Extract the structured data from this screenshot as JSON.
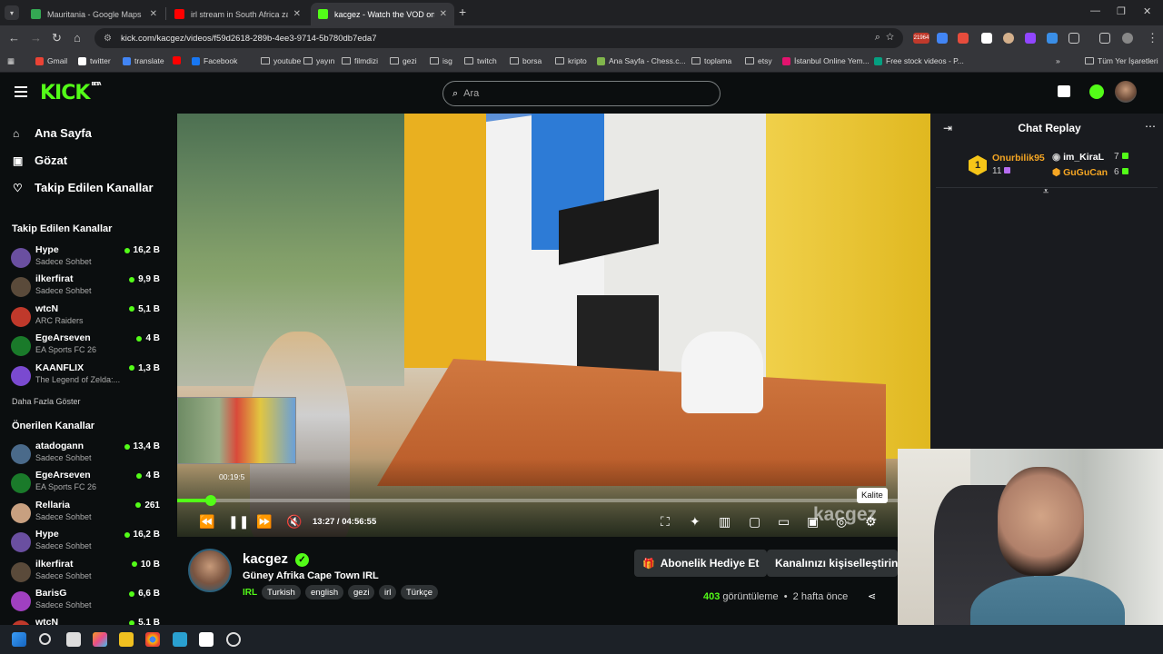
{
  "browser": {
    "tabs": [
      {
        "title": "Mauritania - Google Maps",
        "favicon_color": "#34a853"
      },
      {
        "title": "irl stream in South Africa za (Ne",
        "favicon_color": "#ff0000"
      },
      {
        "title": "kacgez - Watch the VOD on Kic",
        "favicon_color": "#53fc18",
        "active": true
      }
    ],
    "url": "kick.com/kacgez/videos/f59d2618-289b-4ee3-9714-5b780db7eda7",
    "extension_badge": "21964",
    "bookmarks": [
      {
        "label": "Gmail",
        "icon": "gmail-icon",
        "color": "#ea4335"
      },
      {
        "label": "twitter",
        "icon": "x-icon",
        "color": "#ffffff"
      },
      {
        "label": "translate",
        "icon": "translate-icon",
        "color": "#4285f4"
      },
      {
        "label": "",
        "icon": "youtube-icon",
        "color": "#ff0000"
      },
      {
        "label": "Facebook",
        "icon": "facebook-icon",
        "color": "#1877f2"
      },
      {
        "label": "youtube",
        "icon": "folder-icon",
        "color": ""
      },
      {
        "label": "yayın",
        "icon": "folder-icon",
        "color": ""
      },
      {
        "label": "filmdizi",
        "icon": "folder-icon",
        "color": ""
      },
      {
        "label": "gezi",
        "icon": "folder-icon",
        "color": ""
      },
      {
        "label": "isg",
        "icon": "folder-icon",
        "color": ""
      },
      {
        "label": "twitch",
        "icon": "folder-icon",
        "color": ""
      },
      {
        "label": "borsa",
        "icon": "folder-icon",
        "color": ""
      },
      {
        "label": "kripto",
        "icon": "folder-icon",
        "color": ""
      },
      {
        "label": "Ana Sayfa - Chess.c...",
        "icon": "chess-icon",
        "color": "#81b64c"
      },
      {
        "label": "toplama",
        "icon": "folder-icon",
        "color": ""
      },
      {
        "label": "etsy",
        "icon": "folder-icon",
        "color": ""
      },
      {
        "label": "İstanbul Online Yem...",
        "icon": "yemeksepeti-icon",
        "color": "#e2136e"
      },
      {
        "label": "Free stock videos - P...",
        "icon": "pexels-icon",
        "color": "#05a081"
      }
    ],
    "all_bookmarks": "Tüm Yer İşaretleri"
  },
  "kick": {
    "logo_text": "KICK",
    "logo_sup": "BETA",
    "search_placeholder": "Ara",
    "accent": "#53fc18"
  },
  "sidebar": {
    "nav": [
      {
        "label": "Ana Sayfa",
        "icon": "home-icon"
      },
      {
        "label": "Gözat",
        "icon": "browse-icon"
      },
      {
        "label": "Takip Edilen Kanallar",
        "icon": "heart-icon"
      }
    ],
    "followed_title": "Takip Edilen Kanallar",
    "followed": [
      {
        "name": "Hype",
        "sub": "Sadece Sohbet",
        "viewers": "16,2 B",
        "avatar_color": "#6a4fa0"
      },
      {
        "name": "ilkerfirat",
        "sub": "Sadece Sohbet",
        "viewers": "9,9 B",
        "avatar_color": "#5a4a3a"
      },
      {
        "name": "wtcN",
        "sub": "ARC Raiders",
        "viewers": "5,1 B",
        "avatar_color": "#c0392b"
      },
      {
        "name": "EgeArseven",
        "sub": "EA Sports FC 26",
        "viewers": "4 B",
        "avatar_color": "#1a7a2a"
      },
      {
        "name": "KAANFLIX",
        "sub": "The Legend of Zelda:...",
        "viewers": "1,3 B",
        "avatar_color": "#7a4ad0"
      }
    ],
    "show_more": "Daha Fazla Göster",
    "recommended_title": "Önerilen Kanallar",
    "recommended": [
      {
        "name": "atadogann",
        "sub": "Sadece Sohbet",
        "viewers": "13,4 B",
        "avatar_color": "#4a6a8a"
      },
      {
        "name": "EgeArseven",
        "sub": "EA Sports FC 26",
        "viewers": "4 B",
        "avatar_color": "#1a7a2a"
      },
      {
        "name": "Rellaria",
        "sub": "Sadece Sohbet",
        "viewers": "261",
        "avatar_color": "#c8a080"
      },
      {
        "name": "Hype",
        "sub": "Sadece Sohbet",
        "viewers": "16,2 B",
        "avatar_color": "#6a4fa0"
      },
      {
        "name": "ilkerfirat",
        "sub": "Sadece Sohbet",
        "viewers": "10 B",
        "avatar_color": "#5a4a3a"
      },
      {
        "name": "BarisG",
        "sub": "Sadece Sohbet",
        "viewers": "6,6 B",
        "avatar_color": "#a040c0"
      },
      {
        "name": "wtcN",
        "sub": "",
        "viewers": "5,1 B",
        "avatar_color": "#c0392b"
      }
    ]
  },
  "player": {
    "hover_time": "00:19:5",
    "time": "13:27 / 04:56:55",
    "progress_fraction": 0.045,
    "tooltip": "Kalite",
    "watermark": "kacgez"
  },
  "channel": {
    "name": "kacgez",
    "title": "Güney Afrika Cape Town IRL",
    "category": "IRL",
    "tags": [
      "Turkish",
      "english",
      "gezi",
      "irl",
      "Türkçe"
    ],
    "gift_button": "Abonelik Hediye Et",
    "customize_button": "Kanalınızı kişiselleştirin",
    "views_count": "403",
    "views_label": "görüntüleme",
    "age": "2 hafta önce"
  },
  "chat": {
    "title": "Chat Replay",
    "leaders": [
      {
        "rank": "1",
        "name": "Onurbilik95",
        "count": "11",
        "name_color": "#f5a623"
      },
      {
        "name": "im_KiraL",
        "count": "7",
        "name_color": "#ffffff"
      },
      {
        "name": "GuGuCan",
        "count": "6",
        "name_color": "#f5a623"
      }
    ]
  }
}
